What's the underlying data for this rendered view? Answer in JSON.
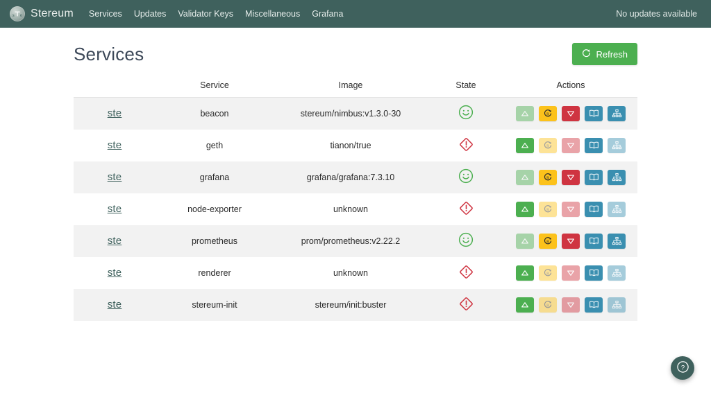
{
  "navbar": {
    "brand": "Stereum",
    "brand_logo_text": "ste",
    "links": [
      "Services",
      "Updates",
      "Validator Keys",
      "Miscellaneous",
      "Grafana"
    ],
    "status": "No updates available",
    "bg_color": "#3f615d"
  },
  "page": {
    "title": "Services",
    "refresh_label": "Refresh",
    "refresh_color": "#4caf50"
  },
  "table": {
    "headers": [
      "",
      "Service",
      "Image",
      "State",
      "Actions"
    ],
    "rows": [
      {
        "logo": "ste",
        "service": "beacon",
        "image": "stereum/nimbus:v1.3.0-30",
        "state": "running",
        "actions": {
          "start": false,
          "restart": true,
          "stop": true,
          "logs": true,
          "config": true
        }
      },
      {
        "logo": "ste",
        "service": "geth",
        "image": "tianon/true",
        "state": "error",
        "actions": {
          "start": true,
          "restart": false,
          "stop": false,
          "logs": true,
          "config": false
        }
      },
      {
        "logo": "ste",
        "service": "grafana",
        "image": "grafana/grafana:7.3.10",
        "state": "running",
        "actions": {
          "start": false,
          "restart": true,
          "stop": true,
          "logs": true,
          "config": true
        }
      },
      {
        "logo": "ste",
        "service": "node-exporter",
        "image": "unknown",
        "state": "error",
        "actions": {
          "start": true,
          "restart": false,
          "stop": false,
          "logs": true,
          "config": false
        }
      },
      {
        "logo": "ste",
        "service": "prometheus",
        "image": "prom/prometheus:v2.22.2",
        "state": "running",
        "actions": {
          "start": false,
          "restart": true,
          "stop": true,
          "logs": true,
          "config": true
        }
      },
      {
        "logo": "ste",
        "service": "renderer",
        "image": "unknown",
        "state": "error",
        "actions": {
          "start": true,
          "restart": false,
          "stop": false,
          "logs": true,
          "config": false
        }
      },
      {
        "logo": "ste",
        "service": "stereum-init",
        "image": "stereum/init:buster",
        "state": "error",
        "actions": {
          "start": true,
          "restart": false,
          "stop": false,
          "logs": true,
          "config": false
        }
      }
    ]
  },
  "icons": {
    "state_running": "smiley-icon",
    "state_error": "warning-diamond-icon",
    "start": "start-triangle-icon",
    "restart": "restart-icon",
    "stop": "stop-triangle-icon",
    "logs": "book-icon",
    "config": "sitemap-icon",
    "refresh": "refresh-icon",
    "help": "question-mark-icon"
  },
  "colors": {
    "running": "#4caf50",
    "error": "#cf3441",
    "start": "#4caf50",
    "restart": "#fcc21b",
    "stop": "#cf3441",
    "blue": "#3a8fb0"
  },
  "help_button": {
    "label": "?"
  }
}
